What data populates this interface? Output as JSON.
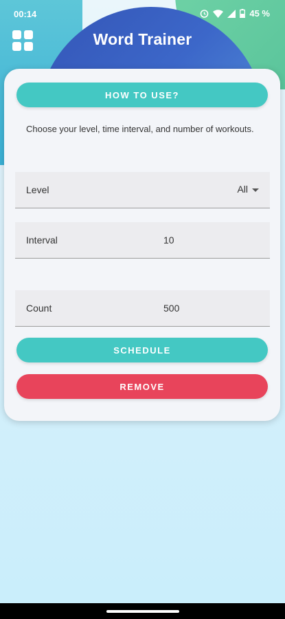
{
  "status_bar": {
    "time": "00:14",
    "battery": "45 %",
    "icons": [
      "alarm-icon",
      "wifi-icon",
      "signal-icon",
      "battery-icon"
    ]
  },
  "header": {
    "title": "Word Trainer",
    "menu_icon": "grid-menu-icon"
  },
  "card": {
    "how_to_label": "HOW TO USE?",
    "intro_text": "Choose your level, time interval, and number of workouts.",
    "fields": {
      "level": {
        "label": "Level",
        "value": "All"
      },
      "interval": {
        "label": "Interval",
        "value": "10"
      },
      "count": {
        "label": "Count",
        "value": "500"
      }
    },
    "schedule_label": "SCHEDULE",
    "remove_label": "REMOVE"
  },
  "colors": {
    "accent_teal": "#44c8c3",
    "danger_red": "#e8445b",
    "header_blue": "#3455b6"
  }
}
